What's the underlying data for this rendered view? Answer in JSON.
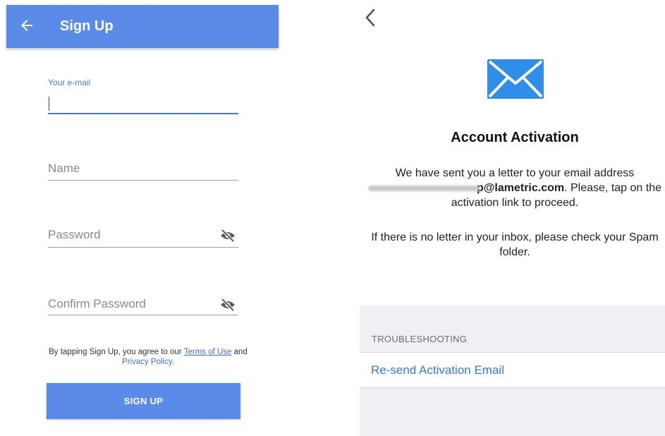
{
  "signup": {
    "title": "Sign Up",
    "email_label": "Your e-mail",
    "name_placeholder": "Name",
    "password_placeholder": "Password",
    "confirm_placeholder": "Confirm Password",
    "terms_prefix": "By tapping Sign Up, you agree to our ",
    "terms_link": "Terms of Use",
    "terms_and": " and ",
    "privacy_link": "Privacy Policy",
    "terms_suffix": ".",
    "button_label": "SIGN UP",
    "accent_color": "#5b8be8"
  },
  "activation": {
    "title": "Account Activation",
    "para1_prefix": "We have sent you a letter to your email address",
    "email_visible": "p@lametric.com",
    "para1_suffix": ". Please, tap on the activation link to proceed.",
    "para2": "If there is no letter in your inbox, please check your Spam folder.",
    "section_label": "TROUBLESHOOTING",
    "resend_label": "Re-send Activation Email",
    "link_color": "#2f7ce0",
    "icon_color": "#2f8ee8"
  }
}
